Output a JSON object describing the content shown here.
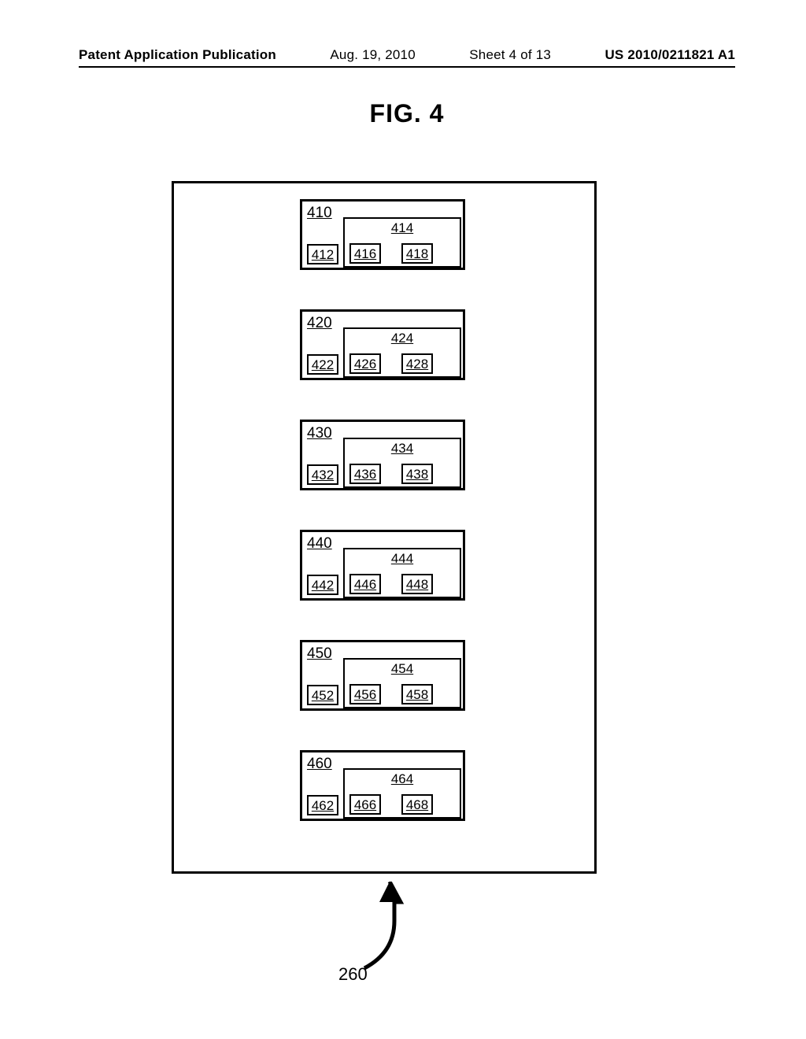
{
  "header": {
    "publication": "Patent Application Publication",
    "date": "Aug. 19, 2010",
    "sheet": "Sheet 4 of 13",
    "number": "US 2010/0211821 A1"
  },
  "figure_title": "FIG.  4",
  "ref_pointer": "260",
  "blocks": [
    {
      "b0": "410",
      "subA": "412",
      "group": "414",
      "gA": "416",
      "gB": "418"
    },
    {
      "b0": "420",
      "subA": "422",
      "group": "424",
      "gA": "426",
      "gB": "428"
    },
    {
      "b0": "430",
      "subA": "432",
      "group": "434",
      "gA": "436",
      "gB": "438"
    },
    {
      "b0": "440",
      "subA": "442",
      "group": "444",
      "gA": "446",
      "gB": "448"
    },
    {
      "b0": "450",
      "subA": "452",
      "group": "454",
      "gA": "456",
      "gB": "458"
    },
    {
      "b0": "460",
      "subA": "462",
      "group": "464",
      "gA": "466",
      "gB": "468"
    }
  ]
}
